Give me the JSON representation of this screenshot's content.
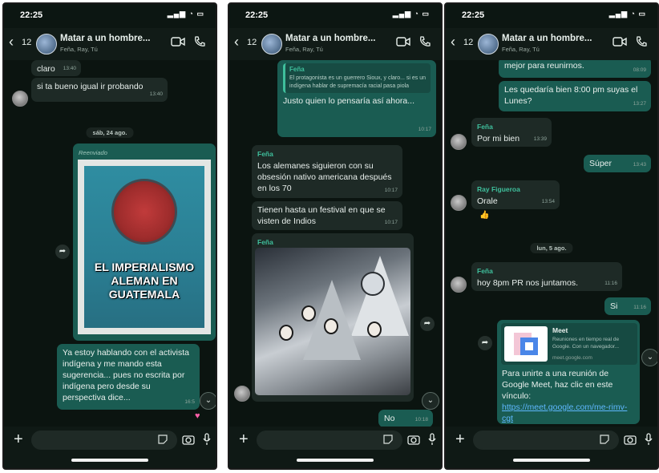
{
  "status": {
    "time": "22:25"
  },
  "chat_header": {
    "back_count": "12",
    "title": "Matar a un hombre...",
    "subtitle": "Feña, Ray, Tú"
  },
  "screen1": {
    "msg_claro": {
      "text": "claro",
      "time": "13:40"
    },
    "msg_bueno": {
      "text": "si ta bueno igual ir probando",
      "time": "13:40"
    },
    "date_pill": "sáb, 24 ago.",
    "forwarded_label": "Reenviado",
    "poster_text": "EL IMPERIALISMO ALEMAN EN GUATEMALA",
    "msg_activista": {
      "text": "Ya estoy hablando con el activista indígena y me mando esta sugerencia... pues no escrita por indígena pero desde su perspectiva dice...",
      "time": "16:5"
    },
    "reaction": "♥"
  },
  "screen2": {
    "quote": {
      "sender": "Feña",
      "text": "El protagonista es un guerrero Sioux, y claro... si es un indígena hablar de supremacía racial pasa piola"
    },
    "msg_justo": {
      "text": "Justo quien lo pensaría así ahora...",
      "time": "10:17"
    },
    "msg_alemanes": {
      "sender": "Feña",
      "text": "Los alemanes siguieron con su obsesión nativo americana después en los 70",
      "time": "10:17"
    },
    "msg_festival": {
      "text": "Tienen hasta un festival en que se visten de Indios",
      "time": "10:17"
    },
    "photo_sender": "Feña",
    "msg_no": {
      "text": "No",
      "time": "10:18"
    }
  },
  "screen3": {
    "msg_top_partial": "mejor para reunirnos.",
    "msg_top_time": "08:09",
    "msg_lunes": {
      "text": "Les quedaría bien 8:00 pm suyas el Lunes?",
      "time": "13:27"
    },
    "msg_bien": {
      "sender": "Feña",
      "text": "Por mi bien",
      "time": "13:39"
    },
    "msg_super": {
      "text": "Súper",
      "time": "13:43"
    },
    "msg_orale": {
      "sender": "Ray Figueroa",
      "text": "Orale",
      "time": "13:54"
    },
    "emoji": "👍",
    "date_pill": "lun, 5 ago.",
    "msg_hoy": {
      "sender": "Feña",
      "text": "hoy 8pm PR nos juntamos.",
      "time": "11:16"
    },
    "msg_si": {
      "text": "Si",
      "time": "11:16"
    },
    "meet": {
      "title": "Meet",
      "desc": "Reuniones en tiempo real de Google. Con un navegador...",
      "domain": "meet.google.com",
      "text": "Para unirte a una reunión de Google Meet, haz clic en este vínculo: ",
      "link": "https://meet.google.com/me-rimv-cgt"
    }
  },
  "colors": {
    "incoming": "#1e2a26",
    "outgoing": "#1a5c52",
    "accent": "#3fbf9c"
  }
}
